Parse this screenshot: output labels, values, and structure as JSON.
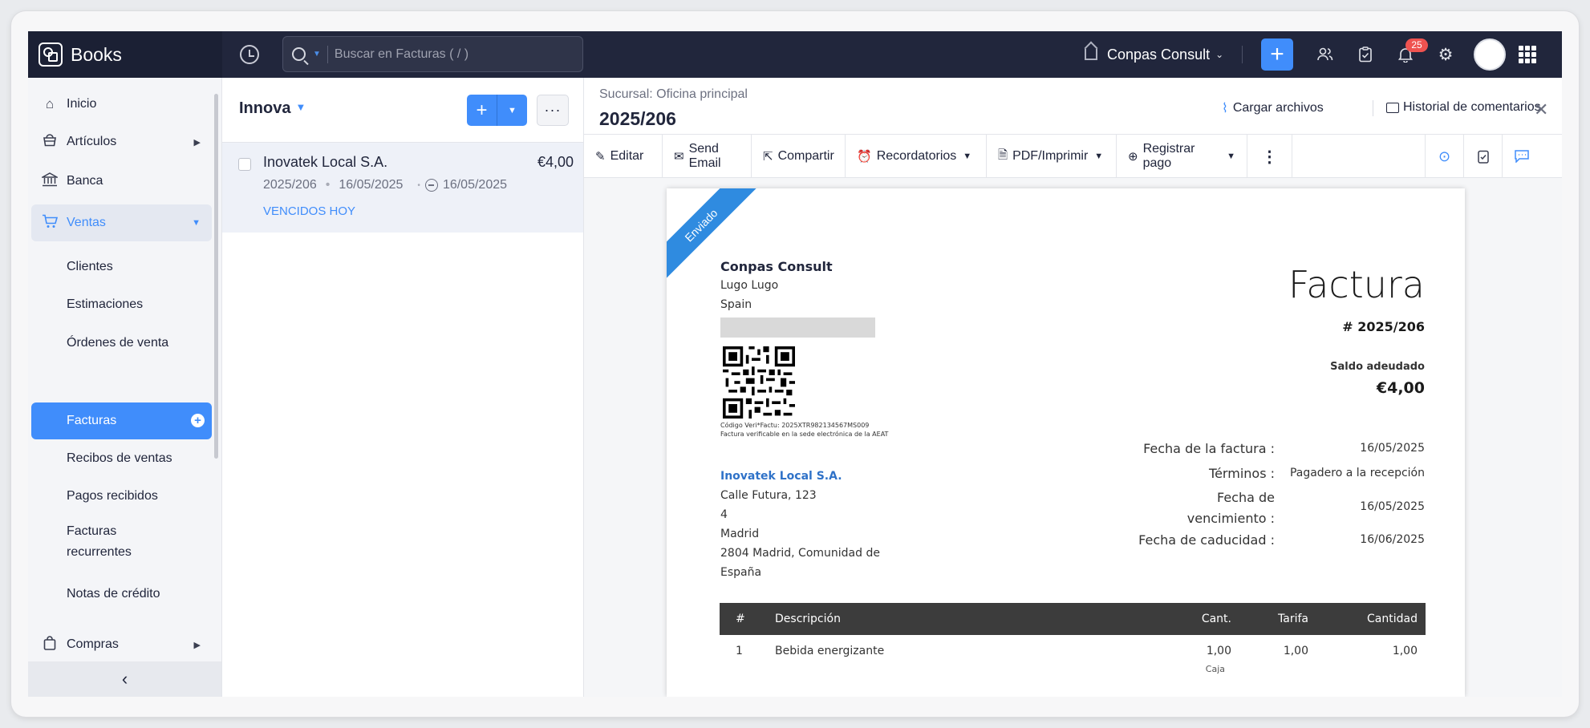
{
  "app": {
    "name": "Books"
  },
  "search": {
    "placeholder": "Buscar en Facturas ( / )"
  },
  "org": {
    "name": "Conpas Consult"
  },
  "notifications": {
    "count": "25"
  },
  "sidebar": {
    "items": [
      {
        "label": "Inicio",
        "icon": "home-icon"
      },
      {
        "label": "Artículos",
        "icon": "basket-icon"
      },
      {
        "label": "Banca",
        "icon": "bank-icon"
      },
      {
        "label": "Ventas",
        "icon": "cart-icon"
      },
      {
        "label": "Compras",
        "icon": "bag-icon"
      }
    ],
    "sub": [
      "Clientes",
      "Estimaciones",
      "Órdenes de venta",
      "Facturas",
      "Recibos de ventas",
      "Pagos recibidos",
      "Facturas recurrentes",
      "Notas de crédito"
    ],
    "collapse_icon": "chevron-left-icon"
  },
  "list": {
    "title": "Innova",
    "rows": [
      {
        "customer": "Inovatek Local S.A.",
        "amount": "€4,00",
        "number": "2025/206",
        "date": "16/05/2025",
        "due": "16/05/2025",
        "status": "VENCIDOS HOY"
      }
    ]
  },
  "detail": {
    "branch": "Sucursal: Oficina principal",
    "number": "2025/206",
    "upload": "Cargar archivos",
    "comments": "Historial de comentarios"
  },
  "toolbar": {
    "edit": "Editar",
    "email": "Send Email",
    "share": "Compartir",
    "reminders": "Recordatorios",
    "pdf": "PDF/Imprimir",
    "payment": "Registrar pago"
  },
  "invoice": {
    "ribbon": "Enviado",
    "company": "Conpas Consult",
    "company_lines": [
      "Lugo Lugo",
      "Spain"
    ],
    "qr_code_line": "Código Veri*Factu: 2025XTR982134567MS009",
    "qr_note_line": "Factura verificable en la sede electrónica de la AEAT",
    "title": "Factura",
    "number": "# 2025/206",
    "balance_label": "Saldo adeudado",
    "balance": "€4,00",
    "meta": [
      {
        "label": "Fecha de la factura :",
        "value": "16/05/2025"
      },
      {
        "label": "Términos :",
        "value": "Pagadero a la recepción"
      },
      {
        "label": "Fecha de vencimiento :",
        "value": "16/05/2025"
      },
      {
        "label": "Fecha de caducidad :",
        "value": "16/06/2025"
      }
    ],
    "bill_to": {
      "name": "Inovatek Local S.A.",
      "lines": [
        "Calle Futura, 123",
        "4",
        "Madrid",
        "2804 Madrid, Comunidad de",
        "España"
      ]
    },
    "table": {
      "headers": [
        "#",
        "Descripción",
        "Cant.",
        "Tarifa",
        "Cantidad"
      ],
      "rows": [
        {
          "n": "1",
          "desc": "Bebida energizante",
          "qty": "1,00",
          "unit": "Caja",
          "rate": "1,00",
          "amount": "1,00"
        }
      ]
    }
  },
  "colors": {
    "accent": "#408dfb",
    "topbar": "#21263c",
    "ribbon": "#2f8be0",
    "status": "#408dfb"
  }
}
